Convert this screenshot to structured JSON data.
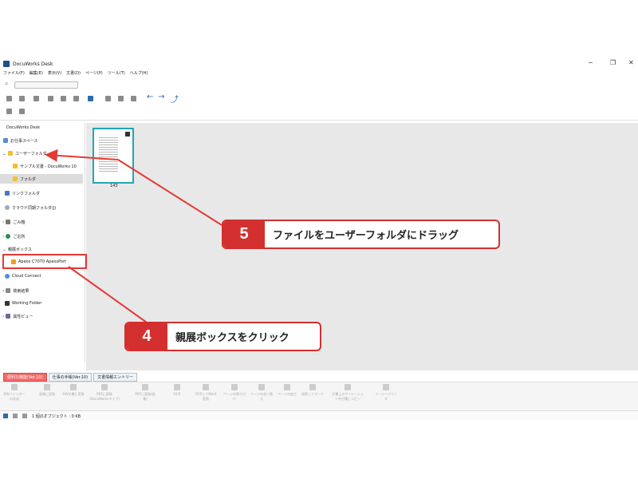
{
  "window": {
    "title": "DocuWorks Desk",
    "min": "─",
    "restore": "❐",
    "close": "✕"
  },
  "menu": [
    "ファイル(F)",
    "編集(E)",
    "表示(V)",
    "文書(D)",
    "ページ(P)",
    "ツール(T)",
    "ヘルプ(H)"
  ],
  "sidebar": {
    "root": "DocuWorks Desk",
    "items": [
      {
        "label": "お仕事スペース"
      },
      {
        "label": "ユーザーフォルダ"
      },
      {
        "label": "サンプル文書 - DocuWorks 10"
      },
      {
        "label": "フォルダ"
      },
      {
        "label": "リンクフォルダ"
      },
      {
        "label": "クラウド同期フォルダ(J)"
      },
      {
        "label": "ごみ箱"
      },
      {
        "label": "ご近所"
      },
      {
        "label": "親展ボックス"
      },
      {
        "label": "Apeos C7070 ApeosPort"
      },
      {
        "label": "Cloud Connect"
      },
      {
        "label": "検索結果"
      },
      {
        "label": "Working Folder"
      },
      {
        "label": "属性ビュー"
      }
    ]
  },
  "content": {
    "thumbnail_label": "143"
  },
  "tabs": [
    {
      "label": "便利な機能(Ver.10)"
    },
    {
      "label": "仕事の手帳(Ver.10)"
    },
    {
      "label": "文書情報エントリー"
    }
  ],
  "bottom_bar": [
    "DWバインダーの作成",
    "画像に変換",
    "DW文書に変換",
    "PDFに変換(DocuWorksタイプ)",
    "PDFに変換(画像)",
    "OCR",
    "OCRしてWord変換",
    "ページの割り付け",
    "ページの並べ替え",
    "ページの加工",
    "検索してマーク",
    "文書上のアノテーションを付箋にコピー",
    "イージープリンタ"
  ],
  "status": {
    "text": "1 個のオブジェクト : 0 KB"
  },
  "callouts": [
    {
      "number": "5",
      "text": "ファイルをユーザーフォルダにドラッグ"
    },
    {
      "number": "4",
      "text": "親展ボックスをクリック"
    }
  ],
  "colors": {
    "accent": "#d32f2f",
    "thumbnail_border": "#20a7b6",
    "active_tab": "#f26b6b"
  }
}
